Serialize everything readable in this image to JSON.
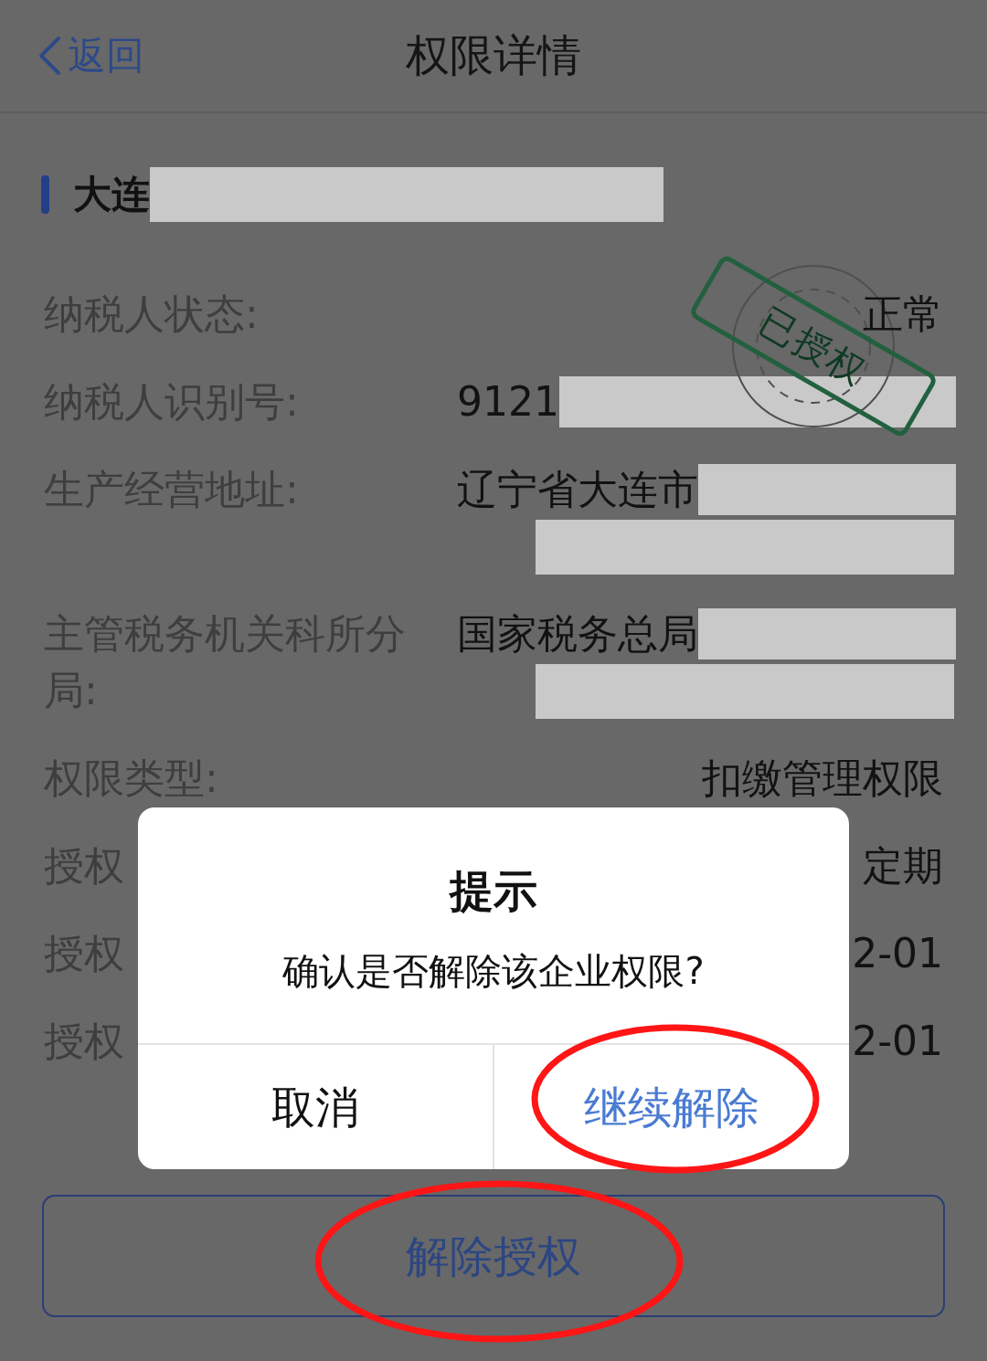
{
  "header": {
    "back": "返回",
    "title": "权限详情"
  },
  "company": {
    "name": "大连",
    "redacted": true
  },
  "stamp": {
    "text": "已授权"
  },
  "fields": [
    {
      "label": "纳税人状态:",
      "value": "正常",
      "redacted": false,
      "redacted_second_line": false
    },
    {
      "label": "纳税人识别号:",
      "value": "9121",
      "redacted": true,
      "redacted_second_line": false
    },
    {
      "label": "生产经营地址:",
      "value": "辽宁省大连市",
      "redacted": true,
      "redacted_second_line": true
    },
    {
      "label": "主管税务机关科所分局:",
      "value": "国家税务总局",
      "redacted": true,
      "redacted_second_line": true
    },
    {
      "label": "权限类型:",
      "value": "扣缴管理权限",
      "redacted": false,
      "redacted_second_line": false
    },
    {
      "label": "授权",
      "value": "定期",
      "redacted": false,
      "redacted_second_line": false
    },
    {
      "label": "授权",
      "value": "2-01",
      "redacted": false,
      "redacted_second_line": false
    },
    {
      "label": "授权",
      "value": "2-01",
      "redacted": false,
      "redacted_second_line": false
    }
  ],
  "dialog": {
    "title": "提示",
    "message": "确认是否解除该企业权限?",
    "buttons": [
      {
        "label": "取消",
        "kind": "cancel",
        "circled": false
      },
      {
        "label": "继续解除",
        "kind": "confirm",
        "circled": true
      }
    ]
  },
  "action_button": {
    "label": "解除授权",
    "circled": true
  }
}
